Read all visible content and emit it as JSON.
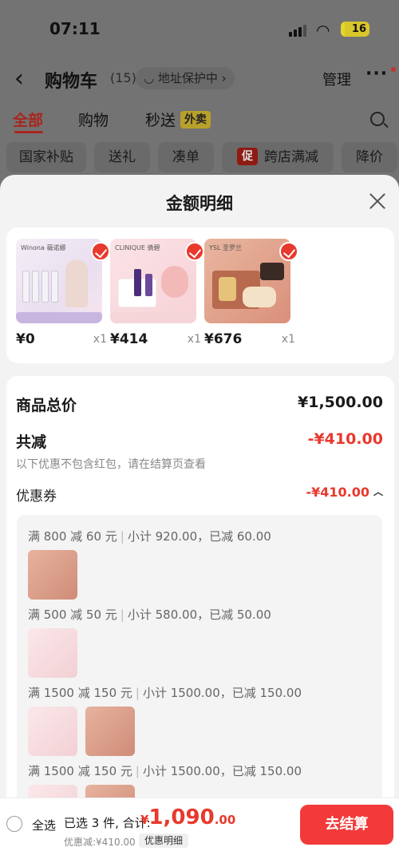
{
  "status_bar": {
    "time": "07:11",
    "battery": "16"
  },
  "nav": {
    "title": "购物车",
    "count": "(15)",
    "address_protect": "◡ 地址保护中 ›",
    "manage": "管理",
    "more": "···"
  },
  "tabs": {
    "all": "全部",
    "shop": "购物",
    "flash": "秒送",
    "takeout_badge": "外卖"
  },
  "chips": {
    "subsidy": "国家补贴",
    "gift": "送礼",
    "bundle": "凑单",
    "promo_icon": "促",
    "cross_store": "跨店满减",
    "price_drop": "降价"
  },
  "sheet": {
    "title": "金额明细",
    "products": [
      {
        "price": "¥0",
        "qty": "x1",
        "image": "thumb-a"
      },
      {
        "price": "¥414",
        "qty": "x1",
        "image": "thumb-b"
      },
      {
        "price": "¥676",
        "qty": "x1",
        "image": "thumb-c"
      }
    ],
    "thumb_texts": {
      "a_brand": "Winona 薇诺娜",
      "b_brand": "CLINIQUE 倩碧",
      "c_brand": "YSL 圣罗兰"
    },
    "total_label": "商品总价",
    "total_value": "¥1,500.00",
    "reduce_label": "共减",
    "reduce_value": "-¥410.00",
    "note": "以下优惠不包含红包，请在结算页查看",
    "coupon_label": "优惠券",
    "coupon_value": "-¥410.00",
    "tiers": [
      {
        "rule": "满 800 减 60 元",
        "detail": "小计 920.00，已减 60.00"
      },
      {
        "rule": "满 500 减 50 元",
        "detail": "小计 580.00，已减 50.00"
      },
      {
        "rule": "满 1500 减 150 元",
        "detail": "小计 1500.00，已减 150.00"
      },
      {
        "rule": "满 1500 减 150 元",
        "detail": "小计 1500.00，已减 150.00"
      }
    ]
  },
  "bottom": {
    "select_all": "全选",
    "summary": "已选 3 件, 合计:",
    "currency": "¥",
    "total_int": "1,090",
    "total_dec": ".00",
    "discount": "优惠减:¥410.00",
    "detail_pill": "优惠明细",
    "checkout": "去结算"
  },
  "colors": {
    "accent_red": "#e8392d",
    "checkout_bg": "#f23a3a"
  }
}
